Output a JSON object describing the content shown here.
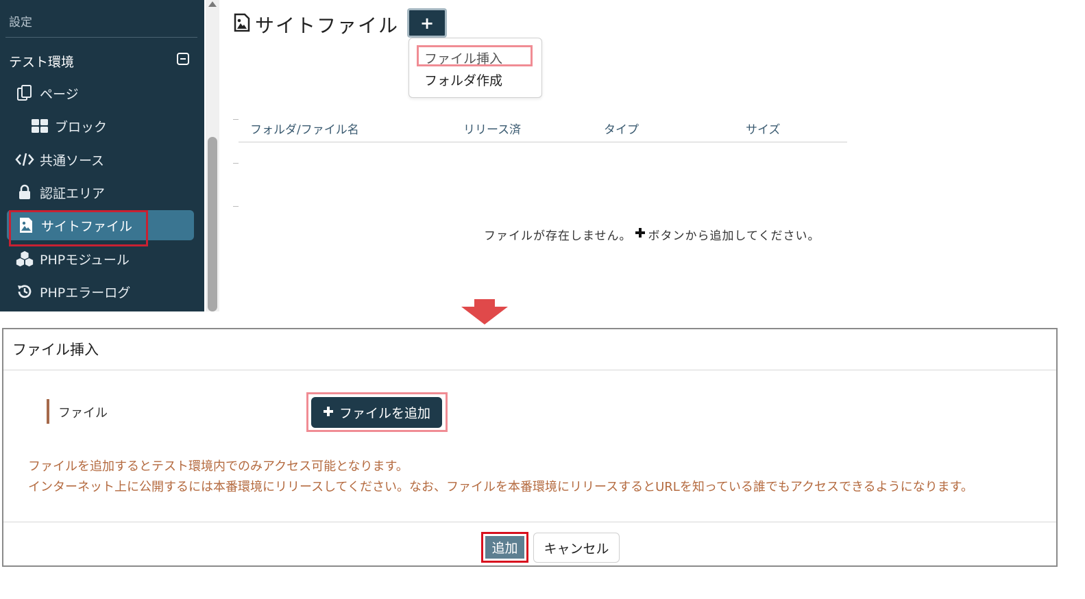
{
  "sidebar": {
    "section_label": "設定",
    "environment_label": "テスト環境",
    "items": [
      {
        "label": "ページ",
        "icon": "pages-icon"
      },
      {
        "label": "ブロック",
        "icon": "blocks-icon"
      },
      {
        "label": "共通ソース",
        "icon": "code-icon"
      },
      {
        "label": "認証エリア",
        "icon": "lock-icon"
      },
      {
        "label": "サイトファイル",
        "icon": "image-file-icon"
      },
      {
        "label": "PHPモジュール",
        "icon": "cubes-icon"
      },
      {
        "label": "PHPエラーログ",
        "icon": "history-icon"
      }
    ],
    "active_item": "サイトファイル"
  },
  "main": {
    "title": "サイトファイル",
    "add_button_label": "+",
    "dropdown": [
      "ファイル挿入",
      "フォルダ作成"
    ],
    "table_headers": [
      "フォルダ/ファイル名",
      "リリース済",
      "タイプ",
      "サイズ"
    ],
    "empty_message_before": "ファイルが存在しません。",
    "empty_message_after": "ボタンから追加してください。"
  },
  "dialog": {
    "title": "ファイル挿入",
    "field_label": "ファイル",
    "add_file_button": "ファイルを追加",
    "note_line1": "ファイルを追加するとテスト環境内でのみアクセス可能となります。",
    "note_line2": "インターネット上に公開するには本番環境にリリースしてください。なお、ファイルを本番環境にリリースするとURLを知っている誰でもアクセスできるようになります。",
    "submit_button": "追加",
    "cancel_button": "キャンセル"
  },
  "colors": {
    "sidebar_bg": "#1c3645",
    "active_item_bg": "#3a7591",
    "primary_button": "#1e3a4a",
    "highlight_red": "#c82132",
    "highlight_pink": "#f08c94",
    "note_text": "#b46a3f",
    "arrow": "#e0494a"
  }
}
